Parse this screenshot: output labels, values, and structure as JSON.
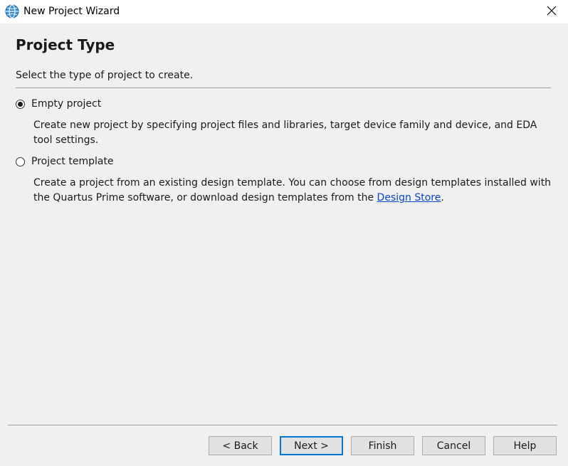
{
  "window": {
    "title": "New Project Wizard"
  },
  "icons": {
    "app": "quartus-globe-icon",
    "close": "close-icon"
  },
  "page": {
    "title": "Project Type",
    "subtitle": "Select the type of project to create."
  },
  "options": [
    {
      "label": "Empty project",
      "checked": true,
      "description": "Create new project by specifying project files and libraries, target device family and device, and EDA tool settings."
    },
    {
      "label": "Project template",
      "checked": false,
      "description_before": "Create a project from an existing design template. You can choose from design templates installed with the Quartus Prime software, or download design templates from the ",
      "link_text": "Design Store",
      "description_after": "."
    }
  ],
  "buttons": {
    "back": "< Back",
    "next": "Next >",
    "finish": "Finish",
    "cancel": "Cancel",
    "help": "Help"
  },
  "colors": {
    "default_button_border": "#0078d7",
    "link": "#0645c8"
  }
}
